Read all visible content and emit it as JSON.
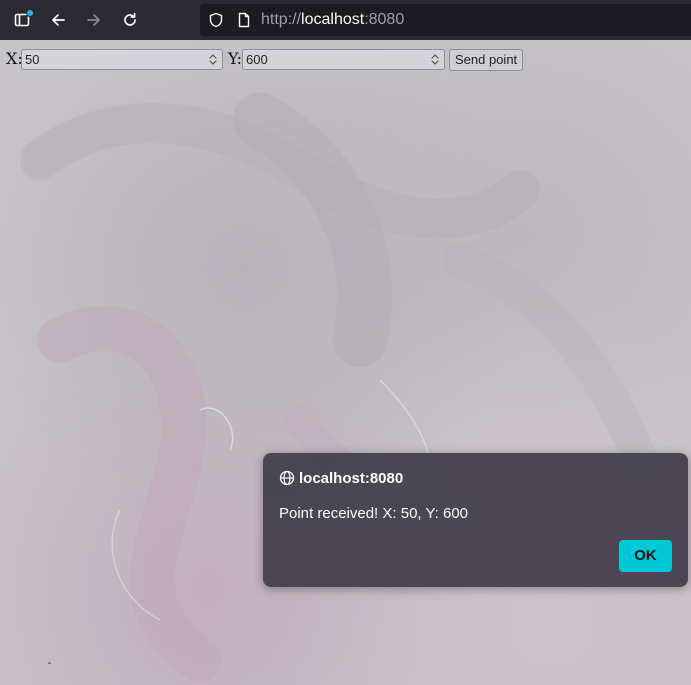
{
  "browser": {
    "url_protocol": "http://",
    "url_host": "localhost",
    "url_port": ":8080"
  },
  "form": {
    "x_label": "X:",
    "x_value": "50",
    "y_label": "Y:",
    "y_value": "600",
    "send_label": "Send point"
  },
  "page": {
    "cursor_glyph": "̂"
  },
  "dialog": {
    "origin": "localhost:8080",
    "message": "Point received! X: 50, Y: 600",
    "ok_label": "OK"
  },
  "colors": {
    "toolbar_bg": "#2b2a33",
    "urlbar_bg": "#1c1b22",
    "dialog_bg": "#3f3d49",
    "accent_button": "#00c8d7",
    "notification_dot": "#1fb1e8"
  },
  "icons": {
    "sidebar": "sidebar-icon",
    "back": "arrow-left-icon",
    "forward": "arrow-right-icon",
    "reload": "reload-icon",
    "tracking_protection": "shield-icon",
    "page_info": "page-icon",
    "dialog_origin": "globe-icon"
  }
}
